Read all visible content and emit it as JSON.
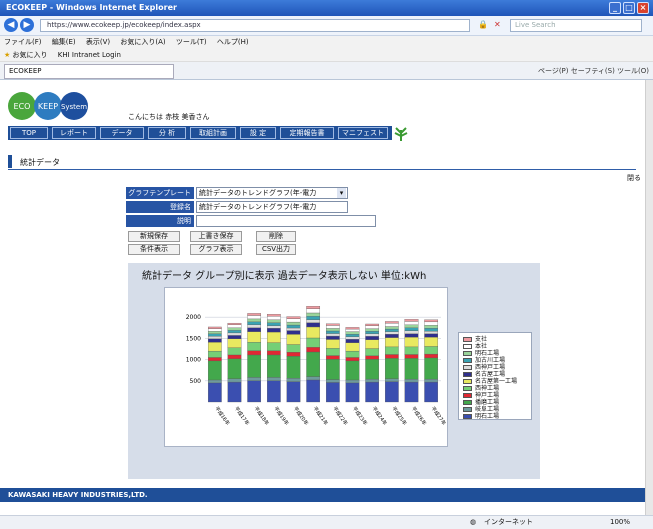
{
  "window": {
    "title": "ECOKEEP - Windows Internet Explorer"
  },
  "address": {
    "url": "https://www.ecokeep.jp/ecokeep/index.aspx",
    "search_placeholder": "Live Search"
  },
  "menu": [
    "ファイル(F)",
    "編集(E)",
    "表示(V)",
    "お気に入り(A)",
    "ツール(T)",
    "ヘルプ(H)"
  ],
  "favorites": {
    "label": "お気に入り",
    "link": "KHI Intranet Login"
  },
  "tab": {
    "label": "ECOKEEP"
  },
  "toolbar": {
    "items": "ページ(P) セーフティ(S) ツール(O)"
  },
  "app": {
    "logo": [
      "ECO",
      "KEEP",
      "System"
    ],
    "welcome": "こんにちは 赤枝 美香さん",
    "nav": [
      "TOP",
      "レポート",
      "データ",
      "分 析",
      "取組計画",
      "設 定",
      "定期報告書",
      "マニフェスト"
    ]
  },
  "page": {
    "header": "統計データ",
    "close_link": "閉る"
  },
  "form": {
    "template_label": "グラフテンプレート",
    "template_value": "統計データのトレンドグラフ(年-電力",
    "name_label": "登録名",
    "name_value": "統計データのトレンドグラフ(年-電力",
    "desc_label": "説明",
    "desc_value": "",
    "buttons": {
      "save_new": "新規保存",
      "save_over": "上書き保存",
      "delete": "削除",
      "conditions": "条件表示",
      "graph": "グラフ表示",
      "csv": "CSV出力"
    }
  },
  "chart_data": {
    "type": "bar",
    "stacked": true,
    "title": "統計データ グループ別に表示 過去データ表示しない 単位:kWh",
    "categories": [
      "平成16年",
      "平成17年",
      "平成18年",
      "平成19年",
      "平成20年",
      "平成21年",
      "平成22年",
      "平成23年",
      "平成24年",
      "平成25年",
      "平成26年",
      "平成27年"
    ],
    "series": [
      {
        "name": "明石工場",
        "color": "#3b4fb0",
        "values": [
          450,
          470,
          500,
          500,
          480,
          520,
          460,
          450,
          470,
          480,
          470,
          470
        ]
      },
      {
        "name": "岐阜工場",
        "color": "#6e9a9c",
        "values": [
          70,
          80,
          80,
          80,
          80,
          80,
          70,
          70,
          70,
          70,
          70,
          70
        ]
      },
      {
        "name": "播磨工場",
        "color": "#43a84c",
        "values": [
          450,
          470,
          530,
          530,
          520,
          580,
          480,
          450,
          470,
          480,
          490,
          500
        ]
      },
      {
        "name": "神戸工場",
        "color": "#e12833",
        "values": [
          80,
          90,
          100,
          100,
          95,
          110,
          85,
          80,
          80,
          90,
          90,
          90
        ]
      },
      {
        "name": "西神工場",
        "color": "#75cf76",
        "values": [
          150,
          170,
          200,
          190,
          180,
          220,
          170,
          150,
          170,
          180,
          180,
          180
        ]
      },
      {
        "name": "名古屋第一工場",
        "color": "#e9e960",
        "values": [
          210,
          210,
          250,
          250,
          240,
          260,
          210,
          200,
          210,
          220,
          230,
          220
        ]
      },
      {
        "name": "名古屋工場",
        "color": "#2f2f8c",
        "values": [
          80,
          80,
          90,
          90,
          90,
          100,
          80,
          80,
          80,
          80,
          80,
          80
        ]
      },
      {
        "name": "西神戸工場",
        "color": "#dcdcdc",
        "values": [
          60,
          60,
          70,
          60,
          60,
          70,
          60,
          60,
          60,
          60,
          70,
          60
        ]
      },
      {
        "name": "加古川工場",
        "color": "#3aa3b3",
        "values": [
          60,
          60,
          70,
          70,
          70,
          80,
          60,
          60,
          60,
          60,
          70,
          70
        ]
      },
      {
        "name": "明石工場",
        "color": "#9ad49a",
        "values": [
          60,
          60,
          70,
          70,
          70,
          80,
          60,
          60,
          60,
          60,
          70,
          70
        ]
      },
      {
        "name": "本社",
        "color": "#ffffff",
        "values": [
          60,
          70,
          80,
          80,
          80,
          100,
          70,
          60,
          70,
          80,
          80,
          80
        ]
      },
      {
        "name": "支社",
        "color": "#ef9aa0",
        "values": [
          40,
          40,
          50,
          50,
          50,
          60,
          40,
          40,
          40,
          40,
          50,
          50
        ]
      }
    ],
    "ylim": [
      0,
      2500
    ],
    "yticks": [
      "2000",
      "1500",
      "1000",
      "500"
    ],
    "grid": true,
    "legend": "right"
  },
  "footer": {
    "text": "KAWASAKI HEAVY INDUSTRIES,LTD."
  },
  "status": {
    "zone": "インターネット",
    "zoom": "100%"
  }
}
